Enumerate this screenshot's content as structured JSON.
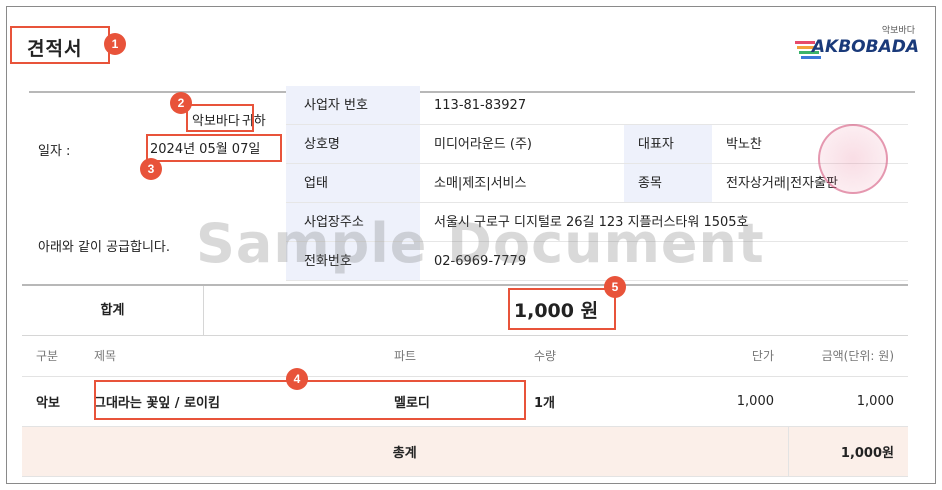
{
  "document": {
    "title": "견적서",
    "addressee": "악보바다",
    "addressee_suffix": "귀하",
    "date_label": "일자 :",
    "date_value": "2024년 05월 07일",
    "supply_note": "아래와 같이 공급합니다.",
    "watermark": "Sample Document"
  },
  "logo": {
    "small_text": "악보바다",
    "main_text": "AKBOBADA"
  },
  "supplier": {
    "rows": [
      {
        "key": "사업자 번호",
        "value": "113-81-83927"
      },
      {
        "key": "상호명",
        "value": "미디어라운드 (주)",
        "key2": "대표자",
        "value2": "박노찬"
      },
      {
        "key": "업태",
        "value": "소매|제조|서비스",
        "key2": "종목",
        "value2": "전자상거래|전자출판"
      },
      {
        "key": "사업장주소",
        "value": "서울시 구로구 디지털로 26길 123 지플러스타워 1505호"
      },
      {
        "key": "전화번호",
        "value": "02-6969-7779"
      }
    ]
  },
  "total": {
    "label": "합계",
    "value": "1,000 원"
  },
  "items": {
    "headers": [
      "구분",
      "제목",
      "파트",
      "수량",
      "단가",
      "금액(단위: 원)"
    ],
    "rows": [
      {
        "category": "악보",
        "title": "그대라는 꽃잎 / 로이킴",
        "part": "멜로디",
        "qty": "1개",
        "unit_price": "1,000",
        "amount": "1,000"
      }
    ],
    "sum_label": "총계",
    "sum_value": "1,000원"
  },
  "annotations": [
    "1",
    "2",
    "3",
    "4",
    "5"
  ],
  "colors": {
    "highlight": "#e8533a",
    "label_bg": "#eef1fb",
    "sum_bg": "#fbefe9"
  }
}
